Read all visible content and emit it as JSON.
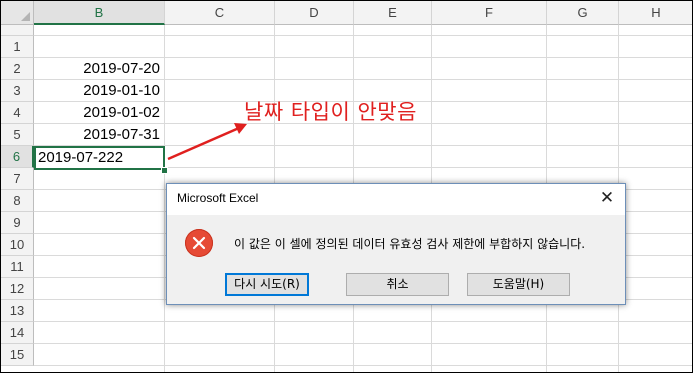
{
  "columns": [
    "B",
    "C",
    "D",
    "E",
    "F",
    "G",
    "H"
  ],
  "selected_column": "B",
  "rows": [
    "1",
    "2",
    "3",
    "4",
    "5",
    "6",
    "7",
    "8",
    "9",
    "10",
    "11",
    "12",
    "13",
    "14",
    "15"
  ],
  "selected_row": "6",
  "cells": {
    "B2": "2019-07-20",
    "B3": "2019-01-10",
    "B4": "2019-01-02",
    "B5": "2019-07-31",
    "B6": "2019-07-222"
  },
  "annotation": {
    "text": "날짜 타입이 안맞음",
    "color": "#e0201f"
  },
  "dialog": {
    "title": "Microsoft Excel",
    "close_glyph": "✕",
    "icon": "error-icon",
    "message": "이 값은 이 셀에 정의된 데이터 유효성 검사 제한에 부합하지 않습니다.",
    "buttons": [
      "다시 시도(R)",
      "취소",
      "도움말(H)"
    ]
  },
  "colors": {
    "excel_green": "#217346",
    "error_red": "#e64a35",
    "focus_blue": "#0078d7"
  }
}
